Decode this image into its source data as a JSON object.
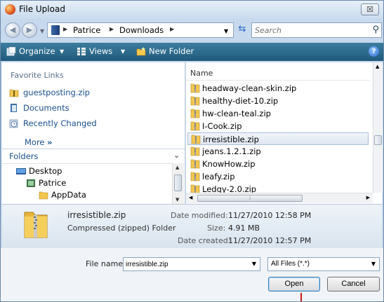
{
  "window": {
    "title": "File Upload",
    "close_glyph": "☒"
  },
  "address_bar": {
    "crumbs": [
      "Patrice",
      "Downloads"
    ],
    "search_placeholder": "Search"
  },
  "toolbar": {
    "organize": "Organize",
    "views": "Views",
    "new_folder": "New Folder"
  },
  "left_pane": {
    "favorites_heading": "Favorite Links",
    "favorites": [
      "guestposting.zip",
      "Documents",
      "Recently Changed"
    ],
    "more_label": "More",
    "more_glyph": "»",
    "folders_label": "Folders",
    "tree": [
      "Desktop",
      "Patrice",
      "AppData"
    ]
  },
  "file_list": {
    "column_name": "Name",
    "files": [
      "headway-clean-skin.zip",
      "healthy-diet-10.zip",
      "hw-clean-teal.zip",
      "I-Cook.zip",
      "irresistible.zip",
      "jeans.1.2.1.zip",
      "KnowHow.zip",
      "leafy.zip",
      "Ledgy-2.0.zip"
    ],
    "selected_index": 4
  },
  "details": {
    "name": "irresistible.zip",
    "type": "Compressed (zipped) Folder",
    "date_modified_label": "Date modified:",
    "date_modified": "11/27/2010 12:58 PM",
    "size_label": "Size:",
    "size": "4.91 MB",
    "date_created_label": "Date created:",
    "date_created": "11/27/2010 12:57 PM"
  },
  "bottom": {
    "file_name_label": "File name:",
    "file_name_value": "irresistible.zip",
    "filter_value": "All Files (*.*)",
    "open_label": "Open",
    "cancel_label": "Cancel"
  },
  "colors": {
    "toolbar": "#2a6a8e",
    "link": "#1b4f8e",
    "pointer": "#c41c1c"
  }
}
